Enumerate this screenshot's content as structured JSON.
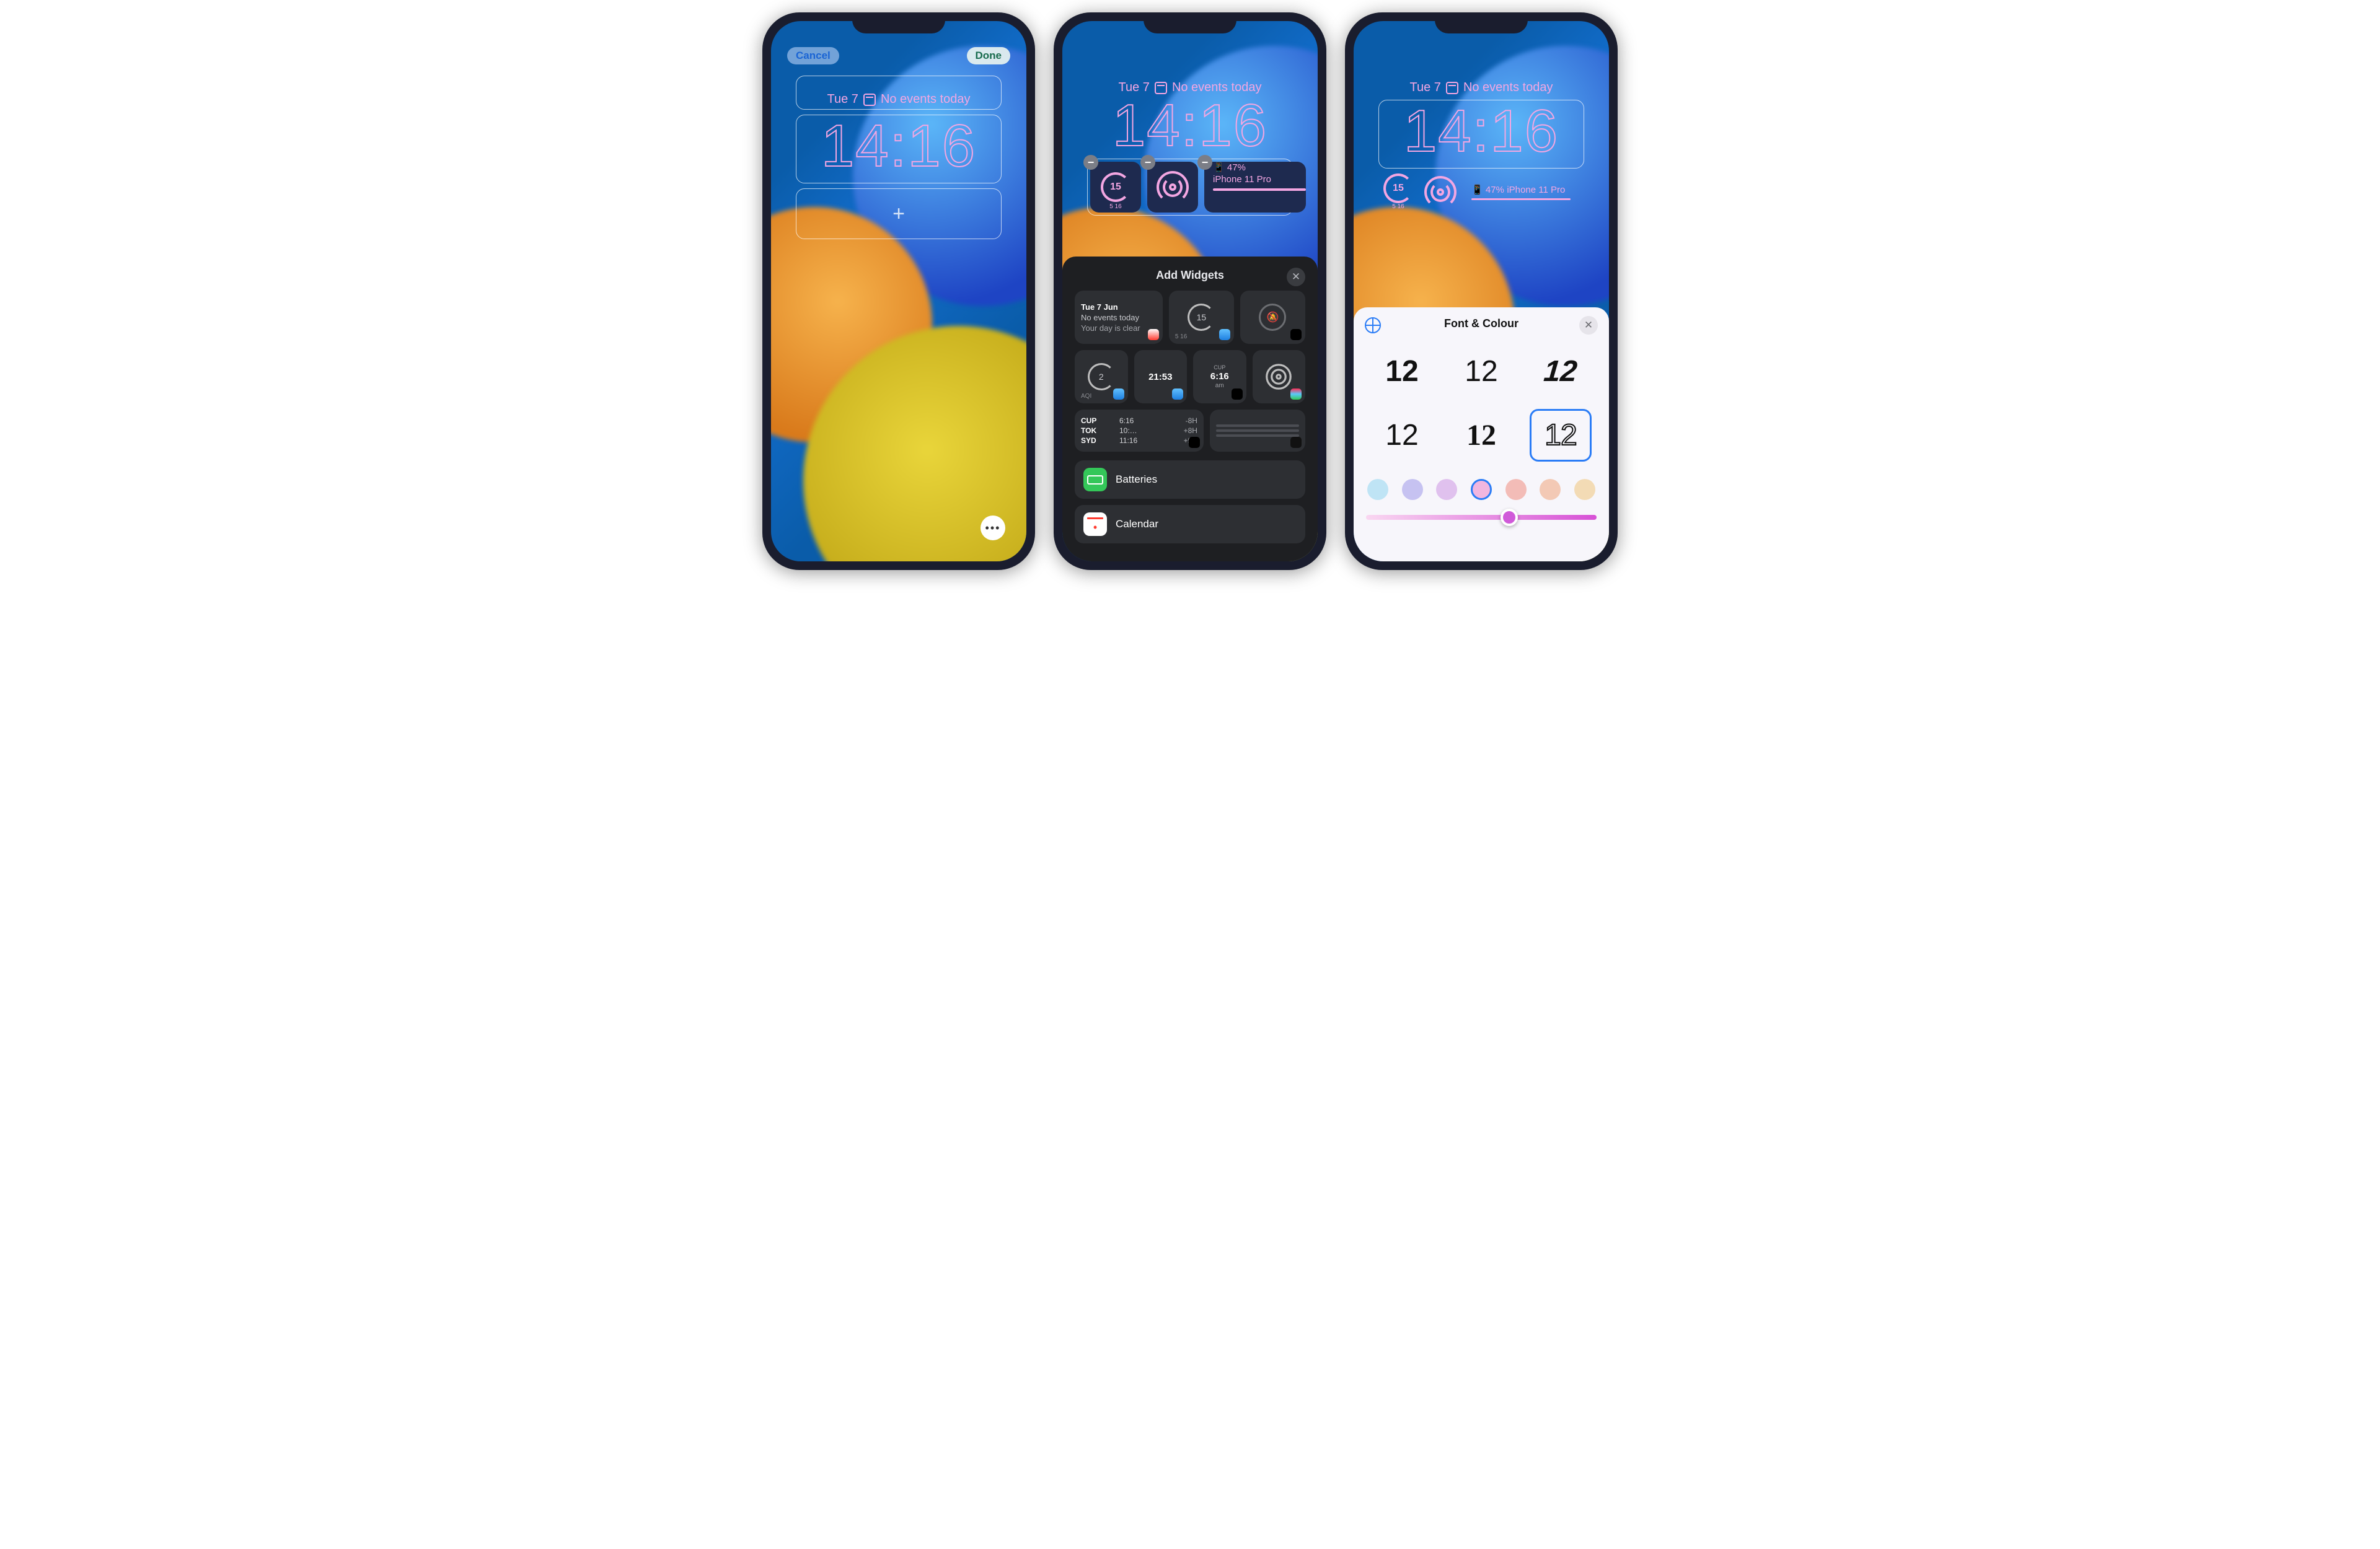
{
  "date_line": {
    "date": "Tue 7",
    "events": "No events today"
  },
  "clock": "14:16",
  "phone1": {
    "cancel": "Cancel",
    "done": "Done",
    "add_glyph": "+"
  },
  "phone2": {
    "widgets": {
      "weather_value": "15",
      "weather_range": "5  16",
      "battery_pct": "47%",
      "battery_device": "iPhone 11 Pro"
    },
    "sheet_title": "Add Widgets",
    "suggest": {
      "cal_date": "Tue 7 Jun",
      "cal_line1": "No events today",
      "cal_line2": "Your day is clear",
      "weather_val": "15",
      "weather_range": "5  16",
      "aqi_val": "2",
      "aqi_lbl": "AQI",
      "wc_time": "21:53",
      "cup_city": "CUP",
      "cup_time": "6:16",
      "cup_ampm": "am",
      "cities": [
        {
          "code": "CUP",
          "time": "6:16",
          "offset": "-8H"
        },
        {
          "code": "TOK",
          "time": "10:…",
          "offset": "+8H"
        },
        {
          "code": "SYD",
          "time": "11:16",
          "offset": "+9H"
        }
      ]
    },
    "apps": {
      "batteries": "Batteries",
      "calendar": "Calendar"
    }
  },
  "phone3": {
    "sheet_title": "Font & Colour",
    "font_sample": "12",
    "slider_pos_pct": 62,
    "swatches": [
      "#bfe4f5",
      "#c6c2f1",
      "#e0c1ee",
      "#f1b6df",
      "#f3bcb7",
      "#f3c9b5",
      "#f3dbb5"
    ],
    "selected_swatch_index": 3,
    "widgets": {
      "weather_value": "15",
      "weather_range": "5  16",
      "battery_pct": "47%",
      "battery_device": "iPhone 11 Pro"
    }
  }
}
